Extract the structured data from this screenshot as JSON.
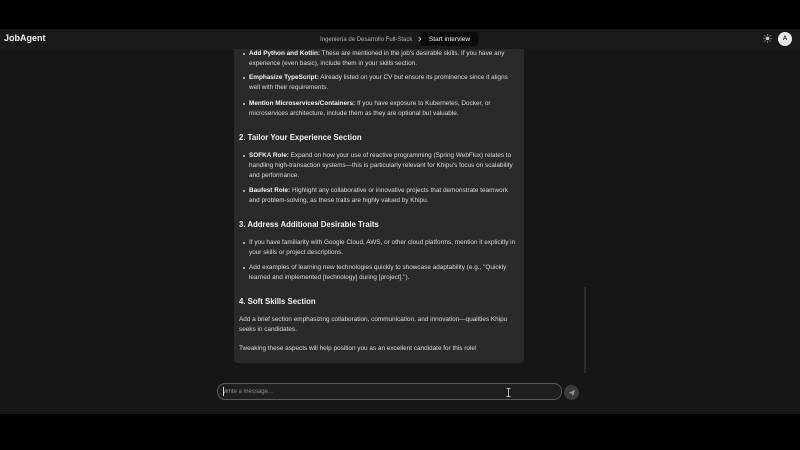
{
  "header": {
    "app_name": "JobAgent",
    "tab_label": "Ingeniería de Desarrollo Full-Stack",
    "tab_close": "✕",
    "start_button": "Start interview",
    "avatar_initial": "A"
  },
  "message": {
    "bullets_top": [
      {
        "bold": "Add Python and Kotlin:",
        "text": " These are mentioned in the job's desirable skills. If you have any experience (even basic), include them in your skills section."
      },
      {
        "bold": "Emphasize TypeScript:",
        "text": " Already listed on your CV but ensure its prominence since it aligns well with their requirements."
      },
      {
        "bold": "Mention Microservices/Containers:",
        "text": " If you have exposure to Kubernetes, Docker, or microservices architecture, include them as they are optional but valuable."
      }
    ],
    "section2": {
      "heading": "2. Tailor Your Experience Section",
      "bullets": [
        {
          "bold": "SOFKA Role:",
          "text": " Expand on how your use of reactive programming (Spring WebFlux) relates to handling high-transaction systems—this is particularly relevant for Khipu's focus on scalability and performance."
        },
        {
          "bold": "Baufest Role:",
          "text": " Highlight any collaborative or innovative projects that demonstrate teamwork and problem-solving, as these traits are highly valued by Khipu."
        }
      ]
    },
    "section3": {
      "heading": "3. Address Additional Desirable Traits",
      "bullets": [
        {
          "text": "If you have familiarity with Google Cloud, AWS, or other cloud platforms, mention it explicitly in your skills or project descriptions."
        },
        {
          "text": "Add examples of learning new technologies quickly to showcase adaptability (e.g., \"Quickly learned and implemented [technology] during [project].\")."
        }
      ]
    },
    "section4": {
      "heading": "4. Soft Skills Section",
      "paragraph": "Add a brief section emphasizing collaboration, communication, and innovation—qualities Khipu seeks in candidates."
    },
    "closing": "Tweaking these aspects will help position you as an excellent candidate for this role!"
  },
  "composer": {
    "placeholder": "Write a message...",
    "value": ""
  },
  "icons": {
    "theme": "sun-icon",
    "send": "send-icon",
    "close": "close-icon"
  },
  "colors": {
    "background": "#161616",
    "message_bubble": "#2a2a2a",
    "header": "#1a1a1a"
  }
}
